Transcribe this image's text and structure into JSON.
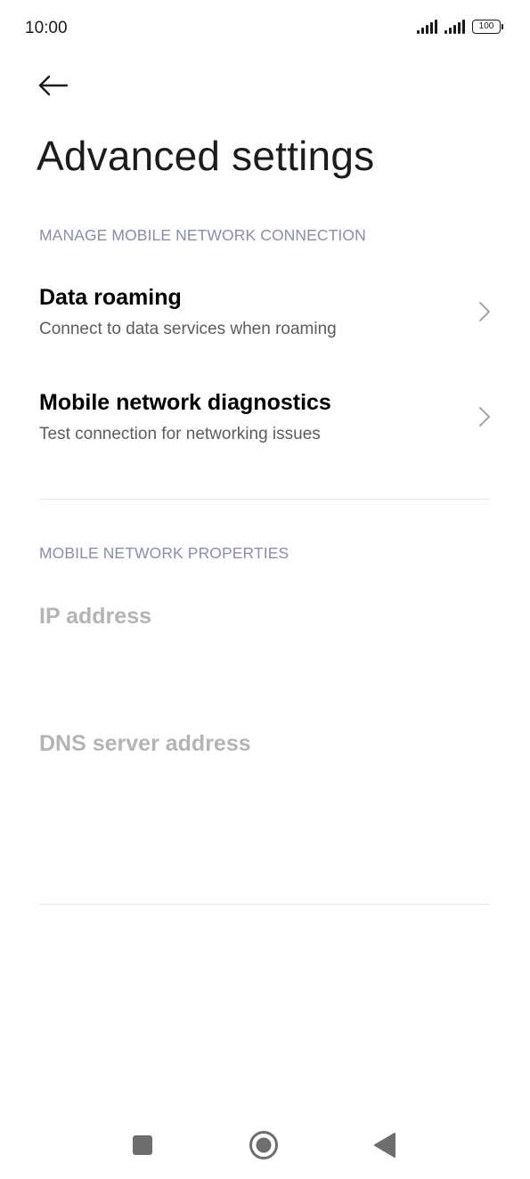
{
  "status_bar": {
    "time": "10:00",
    "battery_level": "100"
  },
  "header": {
    "title": "Advanced settings"
  },
  "sections": {
    "connection": {
      "header": "MANAGE MOBILE NETWORK CONNECTION",
      "items": [
        {
          "title": "Data roaming",
          "subtitle": "Connect to data services when roaming"
        },
        {
          "title": "Mobile network diagnostics",
          "subtitle": "Test connection for networking issues"
        }
      ]
    },
    "properties": {
      "header": "MOBILE NETWORK PROPERTIES",
      "items": [
        {
          "title": "IP address"
        },
        {
          "title": "DNS server address"
        }
      ]
    }
  },
  "icons": {
    "back": "arrow-left-icon",
    "chevron": "chevron-right-icon",
    "nav_recents": "square-icon",
    "nav_home": "circle-icon",
    "nav_back": "triangle-left-icon"
  },
  "colors": {
    "section_header": "#8a8ea8",
    "disabled_text": "#b4b4b4",
    "subtitle": "#5c5c5c",
    "nav_icon": "#6e6e6e"
  }
}
